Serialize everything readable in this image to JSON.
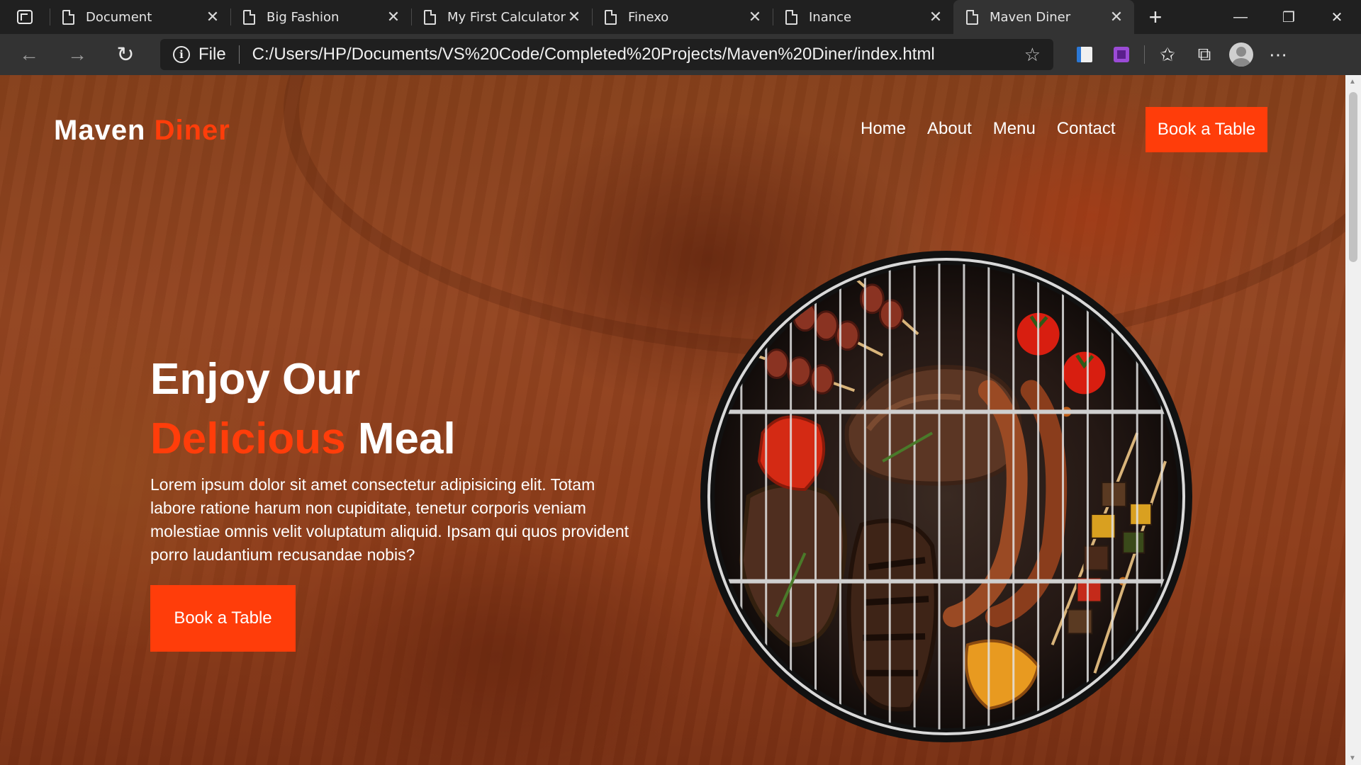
{
  "browser": {
    "tabs": [
      {
        "title": "Document",
        "active": false
      },
      {
        "title": "Big Fashion",
        "active": false
      },
      {
        "title": "My First Calculator",
        "active": false
      },
      {
        "title": "Finexo",
        "active": false
      },
      {
        "title": "Inance",
        "active": false
      },
      {
        "title": "Maven Diner",
        "active": true
      }
    ],
    "address": {
      "scheme": "File",
      "url": "C:/Users/HP/Documents/VS%20Code/Completed%20Projects/Maven%20Diner/index.html"
    }
  },
  "site": {
    "logo": {
      "primary": "Maven",
      "accent": "Diner"
    },
    "nav": [
      "Home",
      "About",
      "Menu",
      "Contact"
    ],
    "cta": "Book a Table",
    "hero": {
      "line1": "Enjoy Our",
      "accent_word": "Delicious",
      "tail_word": "Meal",
      "text": "Lorem ipsum dolor sit amet consectetur adipisicing elit. Totam labore ratione harum non cupiditate, tenetur corporis veniam molestiae omnis velit voluptatum aliquid. Ipsam qui quos provident porro laudantium recusandae nobis?",
      "button": "Book a Table"
    },
    "colors": {
      "accent": "#ff3d0a",
      "text": "#ffffff"
    }
  }
}
